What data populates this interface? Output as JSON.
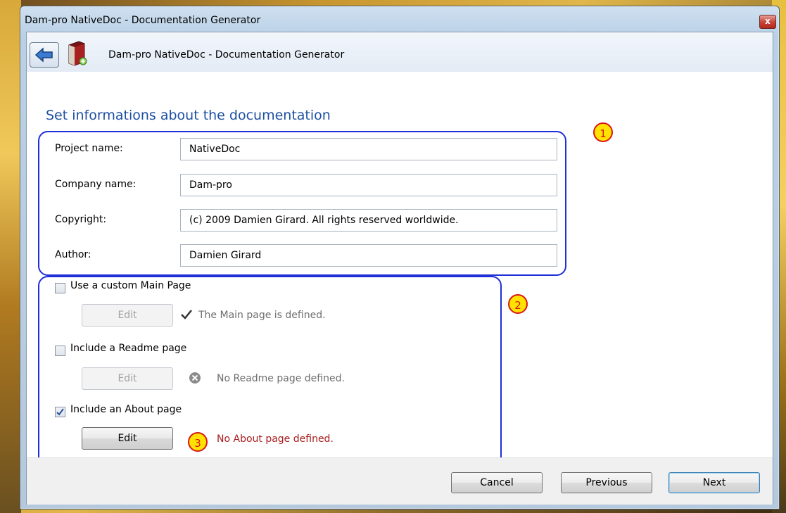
{
  "window": {
    "title": "Dam-pro NativeDoc - Documentation Generator",
    "close_glyph": "x"
  },
  "header": {
    "title": "Dam-pro NativeDoc - Documentation Generator"
  },
  "page": {
    "section_title": "Set informations about the documentation"
  },
  "fields": [
    {
      "label": "Project name:",
      "value": "NativeDoc"
    },
    {
      "label": "Company name:",
      "value": "Dam-pro"
    },
    {
      "label": "Copyright:",
      "value": "(c) 2009 Damien Girard. All rights reserved worldwide."
    },
    {
      "label": "Author:",
      "value": "Damien Girard"
    }
  ],
  "pages": [
    {
      "checkbox_label": "Use a custom Main Page",
      "checked": false,
      "edit_label": "Edit",
      "status": "The Main page is defined.",
      "status_icon": "check-icon"
    },
    {
      "checkbox_label": "Include a Readme page",
      "checked": false,
      "edit_label": "Edit",
      "status": "No Readme page defined.",
      "status_icon": "error-icon"
    },
    {
      "checkbox_label": "Include an About page",
      "checked": true,
      "edit_label": "Edit",
      "status": "No About page defined.",
      "status_icon": "none"
    }
  ],
  "annotations": [
    "1",
    "2",
    "3"
  ],
  "footer": {
    "cancel": "Cancel",
    "previous": "Previous",
    "next": "Next"
  },
  "colors": {
    "title_blue": "#1c4fa0",
    "outline_blue": "#1f2fd8",
    "error_red": "#a81c1c",
    "badge_yellow": "#ffe200"
  }
}
